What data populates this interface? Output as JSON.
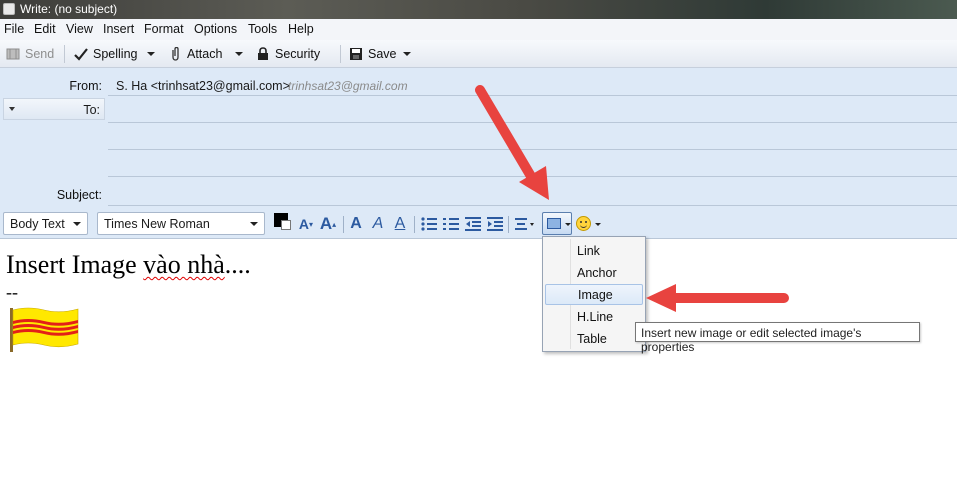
{
  "window": {
    "title": "Write: (no subject)"
  },
  "menubar": [
    "File",
    "Edit",
    "View",
    "Insert",
    "Format",
    "Options",
    "Tools",
    "Help"
  ],
  "toolbar": {
    "send_label": "Send",
    "spelling_label": "Spelling",
    "attach_label": "Attach",
    "security_label": "Security",
    "save_label": "Save"
  },
  "header": {
    "from_label": "From:",
    "from_value": "S. Ha <trinhsat23@gmail.com>",
    "from_account": "trinhsat23@gmail.com",
    "to_label": "To:",
    "subject_label": "Subject:"
  },
  "format": {
    "paragraph_style": "Body Text",
    "font_name": "Times New Roman",
    "text_color": "#000000"
  },
  "body": {
    "line1_prefix": "Insert Image ",
    "line1_misspelled": "vào nhà",
    "line1_suffix": "....",
    "signature_sep": "--"
  },
  "insert_menu": {
    "items": [
      "Link",
      "Anchor",
      "Image",
      "H.Line",
      "Table"
    ],
    "highlighted": "Image"
  },
  "tooltip": "Insert new image or edit selected image's properties",
  "colors": {
    "header_bg": "#dde9f7",
    "arrow": "#e8433f",
    "flag_yellow": "#ffe800",
    "flag_red": "#e32018"
  }
}
